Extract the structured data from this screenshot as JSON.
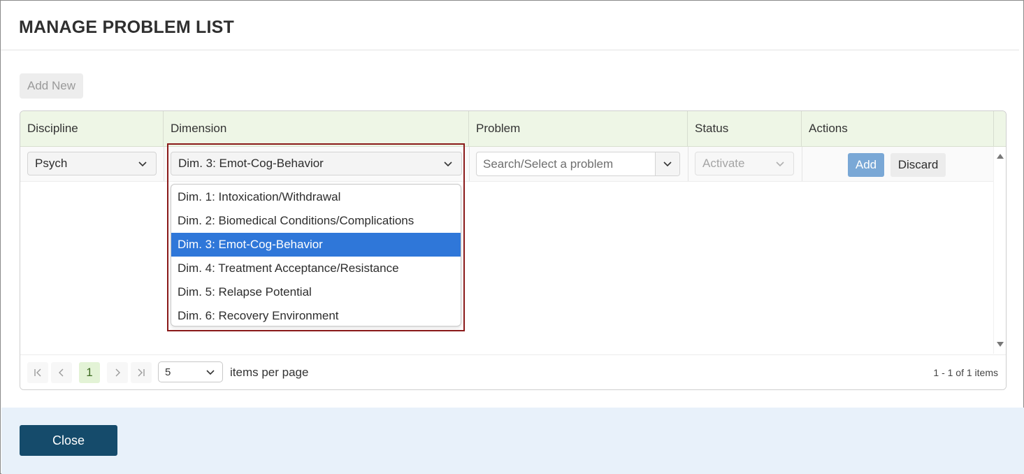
{
  "dialog": {
    "title": "MANAGE PROBLEM LIST",
    "add_new_label": "Add New",
    "close_label": "Close"
  },
  "grid": {
    "columns": [
      "Discipline",
      "Dimension",
      "Problem",
      "Status",
      "Actions"
    ],
    "edit_row": {
      "discipline_value": "Psych",
      "dimension_value": "Dim. 3: Emot-Cog-Behavior",
      "problem_placeholder": "Search/Select a problem",
      "status_value": "Activate",
      "add_label": "Add",
      "discard_label": "Discard"
    }
  },
  "dimension_dropdown": {
    "options": [
      "Dim. 1: Intoxication/Withdrawal",
      "Dim. 2: Biomedical Conditions/Complications",
      "Dim. 3: Emot-Cog-Behavior",
      "Dim. 4: Treatment Acceptance/Resistance",
      "Dim. 5: Relapse Potential",
      "Dim. 6: Recovery Environment"
    ],
    "selected_index": 2
  },
  "pager": {
    "current_page": "1",
    "page_size": "5",
    "items_per_page_label": "items per page",
    "info": "1 - 1 of 1 items"
  },
  "colors": {
    "header_bg": "#eef6e6",
    "selected_option": "#2f77d9",
    "close_button": "#154b6b",
    "highlight_border": "#8b1a1a"
  }
}
